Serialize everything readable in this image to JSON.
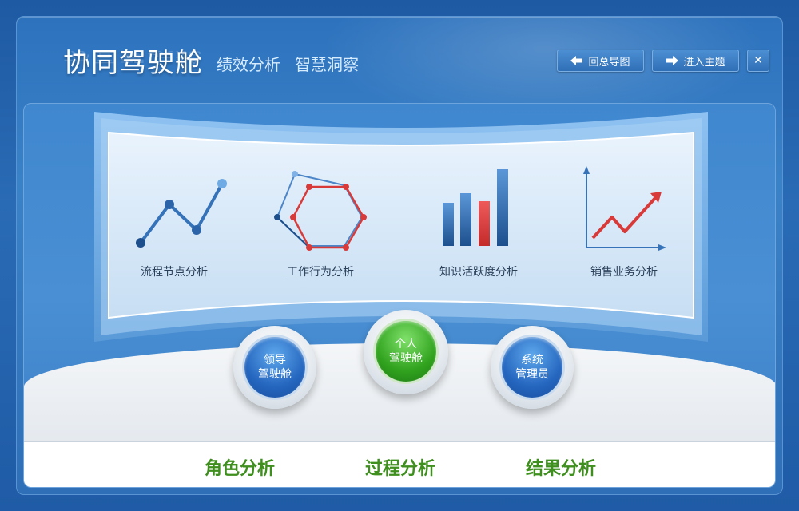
{
  "header": {
    "title": "协同驾驶舱",
    "subtitle_1": "绩效分析",
    "subtitle_2": "智慧洞察"
  },
  "toolbar": {
    "back_label": "回总导图",
    "back_icon": "arrow-left-icon",
    "enter_label": "进入主题",
    "enter_icon": "arrow-right-icon",
    "close_glyph": "✕"
  },
  "features": [
    {
      "label": "流程节点分析",
      "icon": "line-chart-icon"
    },
    {
      "label": "工作行为分析",
      "icon": "hexagon-network-icon"
    },
    {
      "label": "知识活跃度分析",
      "icon": "bar-chart-icon"
    },
    {
      "label": "销售业务分析",
      "icon": "trend-up-chart-icon"
    }
  ],
  "cockpits": [
    {
      "line1": "领导",
      "line2": "驾驶舱",
      "color": "#2566bf"
    },
    {
      "line1": "个人",
      "line2": "驾驶舱",
      "color": "#31a31f"
    },
    {
      "line1": "系统",
      "line2": "管理员",
      "color": "#2566bf"
    }
  ],
  "bottom_tabs": [
    {
      "label": "角色分析"
    },
    {
      "label": "过程分析"
    },
    {
      "label": "结果分析"
    }
  ],
  "colors": {
    "accent_blue": "#2566bf",
    "accent_green": "#3f8f1f",
    "highlight_red": "#d83a3a"
  }
}
